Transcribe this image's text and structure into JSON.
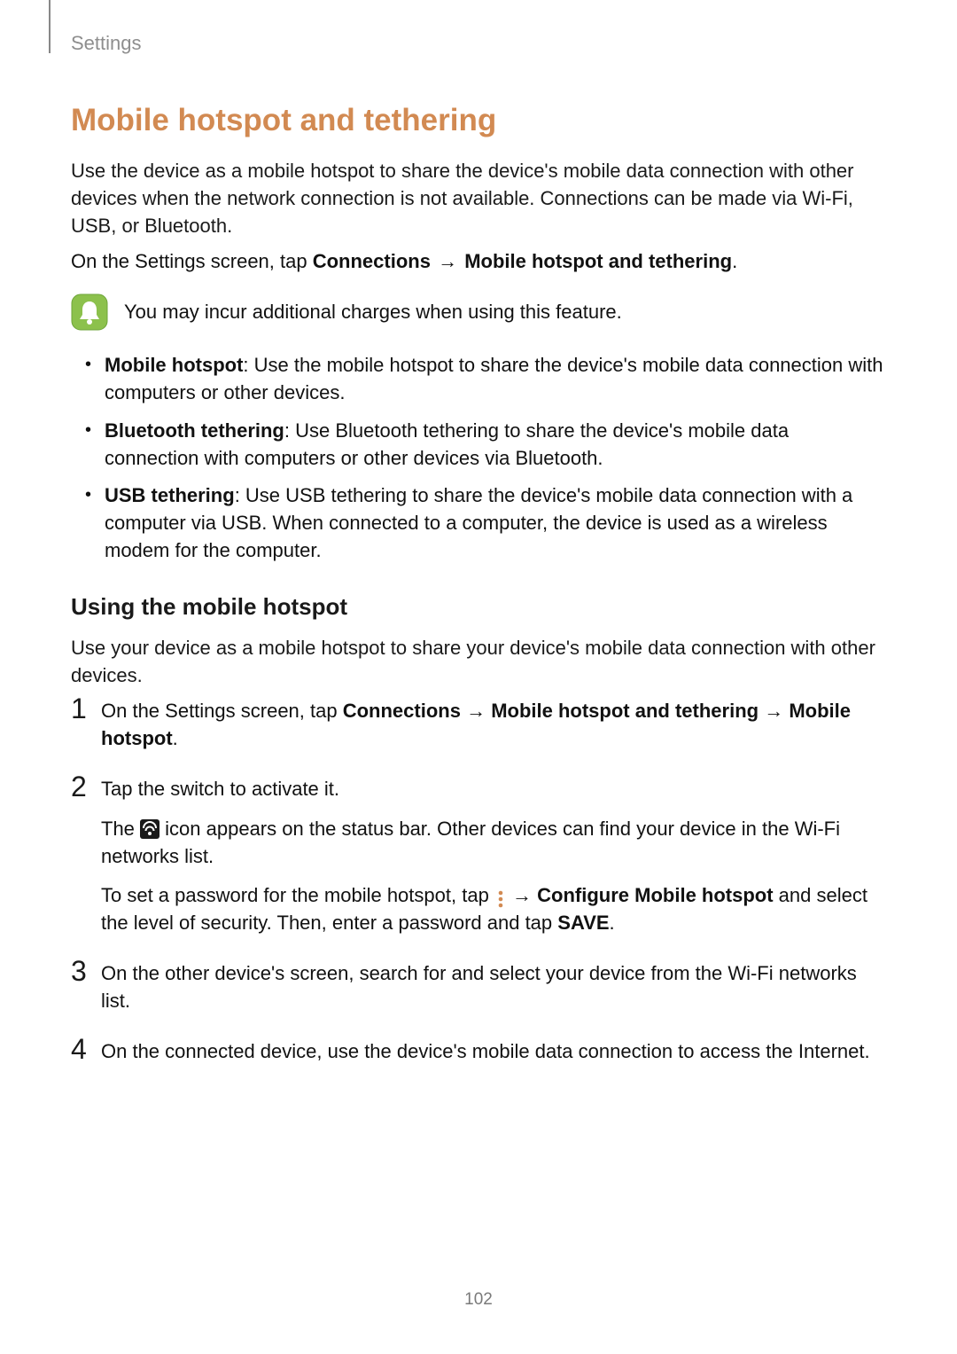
{
  "header": {
    "breadcrumb": "Settings"
  },
  "title": "Mobile hotspot and tethering",
  "intro": "Use the device as a mobile hotspot to share the device's mobile data connection with other devices when the network connection is not available. Connections can be made via Wi-Fi, USB, or Bluetooth.",
  "nav": {
    "prefix": "On the Settings screen, tap ",
    "path1": "Connections",
    "arrow": "→",
    "path2": "Mobile hotspot and tethering",
    "suffix": "."
  },
  "note": {
    "icon_name": "notice-bell-icon",
    "text": "You may incur additional charges when using this feature."
  },
  "features": [
    {
      "term": "Mobile hotspot",
      "desc": ": Use the mobile hotspot to share the device's mobile data connection with computers or other devices."
    },
    {
      "term": "Bluetooth tethering",
      "desc": ": Use Bluetooth tethering to share the device's mobile data connection with computers or other devices via Bluetooth."
    },
    {
      "term": "USB tethering",
      "desc": ": Use USB tethering to share the device's mobile data connection with a computer via USB. When connected to a computer, the device is used as a wireless modem for the computer."
    }
  ],
  "subheading": "Using the mobile hotspot",
  "sub_intro": "Use your device as a mobile hotspot to share your device's mobile data connection with other devices.",
  "steps": {
    "s1": {
      "prefix": "On the Settings screen, tap ",
      "p1": "Connections",
      "p2": "Mobile hotspot and tethering",
      "p3": "Mobile hotspot",
      "suffix": "."
    },
    "s2": {
      "line1": "Tap the switch to activate it.",
      "line2a": "The ",
      "line2b": " icon appears on the status bar. Other devices can find your device in the Wi-Fi networks list.",
      "line3a": "To set a password for the mobile hotspot, tap ",
      "line3b": " → ",
      "line3_bold": "Configure Mobile hotspot",
      "line3c": " and select the level of security. Then, enter a password and tap ",
      "line3_save": "SAVE",
      "line3d": "."
    },
    "s3": "On the other device's screen, search for and select your device from the Wi-Fi networks list.",
    "s4": "On the connected device, use the device's mobile data connection to access the Internet."
  },
  "arrow": "→",
  "page_number": "102"
}
